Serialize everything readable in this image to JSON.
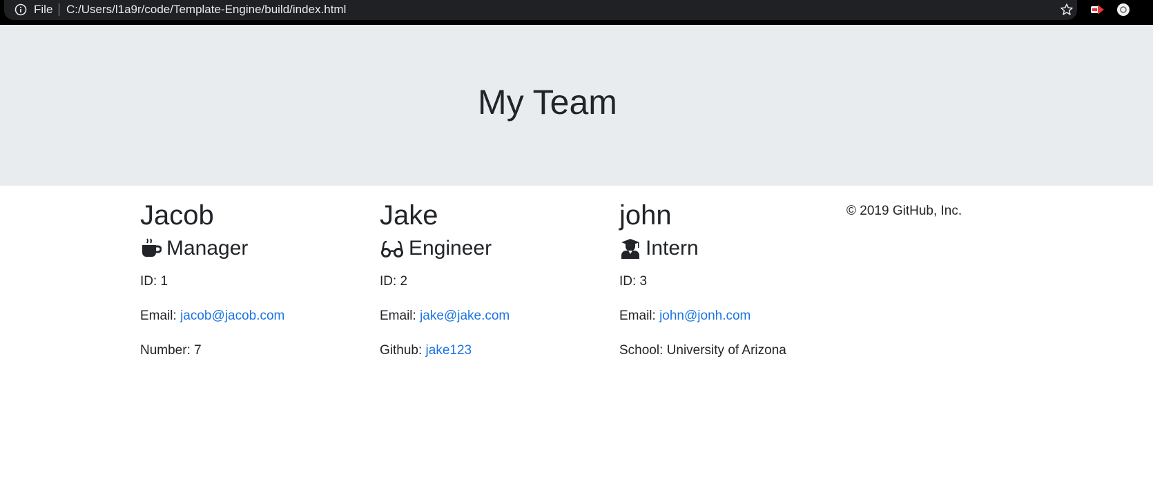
{
  "browser": {
    "file_label": "File",
    "url": "C:/Users/l1a9r/code/Template-Engine/build/index.html"
  },
  "header": {
    "title": "My Team"
  },
  "team": [
    {
      "name": "Jacob",
      "role": "Manager",
      "icon": "coffee-icon",
      "id_text": "ID: 1",
      "email_prefix": "Email: ",
      "email": "jacob@jacob.com",
      "extra_prefix": "Number: 7",
      "extra_link": ""
    },
    {
      "name": "Jake",
      "role": "Engineer",
      "icon": "glasses-icon",
      "id_text": "ID: 2",
      "email_prefix": "Email: ",
      "email": "jake@jake.com",
      "extra_prefix": "Github: ",
      "extra_link": "jake123"
    },
    {
      "name": "john",
      "role": "Intern",
      "icon": "graduate-icon",
      "id_text": "ID: 3",
      "email_prefix": "Email: ",
      "email": "john@jonh.com",
      "extra_prefix": "School: University of Arizona",
      "extra_link": ""
    }
  ],
  "footer": {
    "copyright": "© 2019 GitHub, Inc."
  },
  "colors": {
    "jumbotron_bg": "#e9ecef",
    "link": "#1b74e4",
    "text": "#212529"
  }
}
